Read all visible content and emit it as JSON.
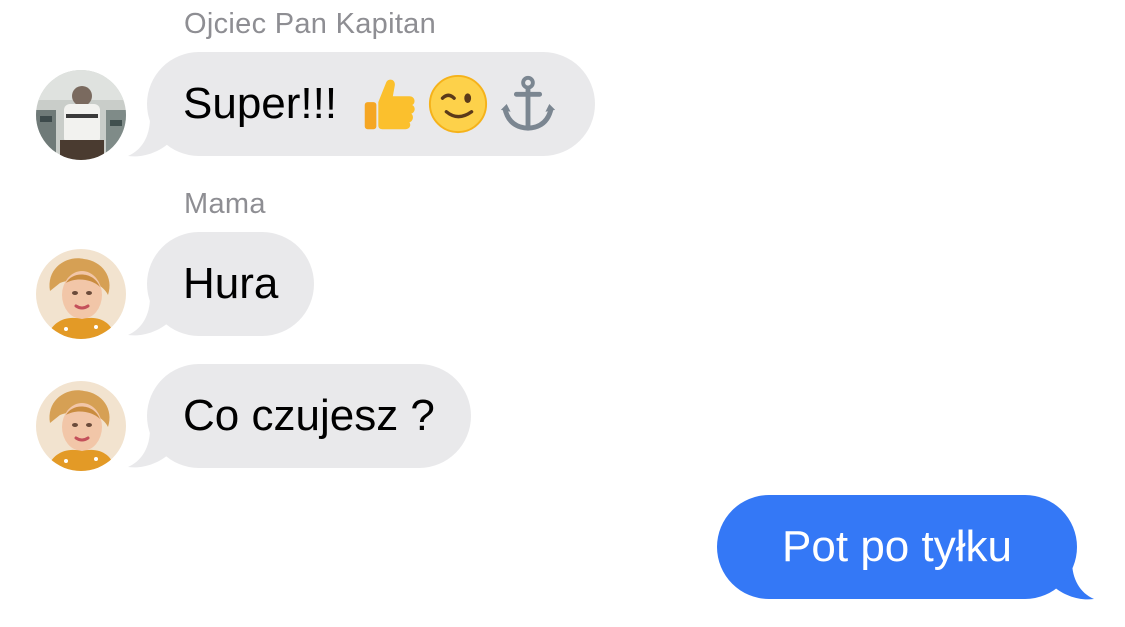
{
  "conversation": {
    "messages": [
      {
        "sender": "Ojciec Pan Kapitan",
        "text": "Super!!!",
        "emojis": [
          "thumbs-up-emoji",
          "winking-face-emoji",
          "anchor-emoji"
        ],
        "direction": "incoming",
        "avatar": "captain-avatar"
      },
      {
        "sender": "Mama",
        "text": "Hura",
        "direction": "incoming",
        "avatar": "mama-avatar"
      },
      {
        "text": "Co czujesz ?",
        "direction": "incoming",
        "avatar": "mama-avatar"
      },
      {
        "text": "Pot po tyłku",
        "direction": "outgoing"
      }
    ]
  },
  "colors": {
    "incoming_bubble": "#e9e9eb",
    "outgoing_bubble": "#3478f6",
    "sender_label": "#8e8e93",
    "incoming_text": "#000000",
    "outgoing_text": "#ffffff"
  }
}
